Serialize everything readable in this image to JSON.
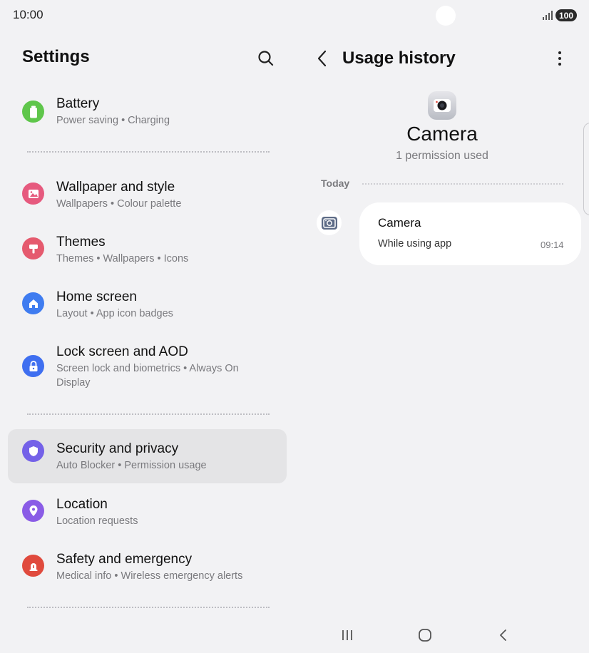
{
  "status_bar": {
    "time": "10:00",
    "battery": "100"
  },
  "left_pane": {
    "title": "Settings",
    "items": [
      {
        "title": "Battery",
        "subtitle": "Power saving • Charging",
        "icon": "battery-icon",
        "color": "#5fc64b"
      },
      {
        "title": "Wallpaper and style",
        "subtitle": "Wallpapers • Colour palette",
        "icon": "wallpaper-icon",
        "color": "#e65a7e"
      },
      {
        "title": "Themes",
        "subtitle": "Themes • Wallpapers • Icons",
        "icon": "themes-icon",
        "color": "#e55a6e"
      },
      {
        "title": "Home screen",
        "subtitle": "Layout • App icon badges",
        "icon": "home-icon",
        "color": "#3f7cf0"
      },
      {
        "title": "Lock screen and AOD",
        "subtitle": "Screen lock and biometrics • Always On Display",
        "icon": "lock-icon",
        "color": "#3f6ff0"
      },
      {
        "title": "Security and privacy",
        "subtitle": "Auto Blocker • Permission usage",
        "icon": "shield-icon",
        "color": "#7461e8"
      },
      {
        "title": "Location",
        "subtitle": "Location requests",
        "icon": "location-pin-icon",
        "color": "#8a5ce6"
      },
      {
        "title": "Safety and emergency",
        "subtitle": "Medical info • Wireless emergency alerts",
        "icon": "emergency-icon",
        "color": "#e04a3d"
      }
    ]
  },
  "right_pane": {
    "title": "Usage history",
    "app_name": "Camera",
    "permission_count": "1 permission used",
    "section_label": "Today",
    "entry": {
      "title": "Camera",
      "subtitle": "While using app",
      "time": "09:14"
    }
  }
}
